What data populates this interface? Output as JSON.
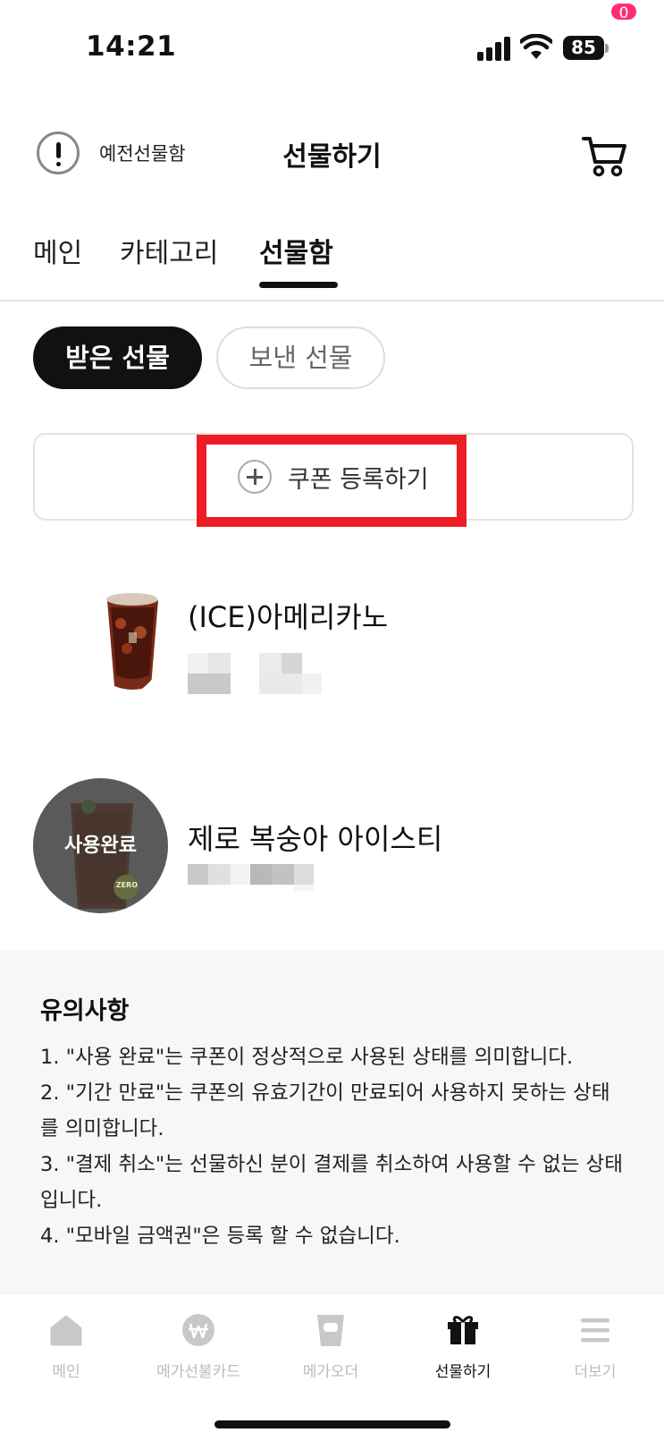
{
  "status_bar": {
    "time": "14:21",
    "battery": "85"
  },
  "header": {
    "old_gift_box": "예전선물함",
    "title": "선물하기",
    "cart_count": "0"
  },
  "tabs": [
    {
      "label": "메인"
    },
    {
      "label": "카테고리"
    },
    {
      "label": "선물함",
      "active": true
    }
  ],
  "toggle": {
    "received": "받은 선물",
    "sent": "보낸 선물"
  },
  "coupon": {
    "register_label": "쿠폰 등록하기"
  },
  "gifts": [
    {
      "name": "(ICE)아메리카노",
      "status": ""
    },
    {
      "name": "제로 복숭아 아이스티",
      "status": "사용완료",
      "badge": "ZERO"
    }
  ],
  "notice": {
    "title": "유의사항",
    "items": [
      "1. \"사용 완료\"는 쿠폰이 정상적으로 사용된 상태를 의미합니다.",
      "2. \"기간 만료\"는 쿠폰의 유효기간이 만료되어 사용하지 못하는 상태를 의미합니다.",
      "3. \"결제 취소\"는 선물하신 분이 결제를 취소하여 사용할 수 없는 상태입니다.",
      "4. \"모바일 금액권\"은 등록 할 수 없습니다."
    ]
  },
  "bottom_nav": [
    {
      "label": "메인",
      "icon": "home-icon"
    },
    {
      "label": "메가선불카드",
      "icon": "won-card-icon"
    },
    {
      "label": "메가오더",
      "icon": "cup-icon"
    },
    {
      "label": "선물하기",
      "icon": "gift-icon",
      "active": true
    },
    {
      "label": "더보기",
      "icon": "menu-icon"
    }
  ],
  "colors": {
    "accent_badge": "#ff2d6f",
    "highlight": "#ee1c24",
    "active": "#111111",
    "inactive": "#bbbbbb"
  }
}
